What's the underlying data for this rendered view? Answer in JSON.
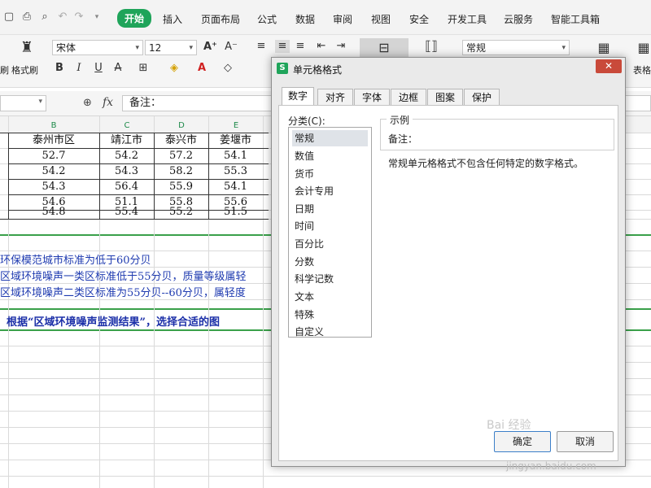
{
  "menubar": {
    "tabs": [
      "开始",
      "插入",
      "页面布局",
      "公式",
      "数据",
      "审阅",
      "视图",
      "安全",
      "开发工具",
      "云服务",
      "智能工具箱"
    ],
    "active_tab": "开始"
  },
  "ribbon": {
    "paste_label_partial": "刷",
    "format_painter_label": "格式刷",
    "font_name": "宋体",
    "font_size": "12",
    "number_format": "常规",
    "table_label_partial": "表格"
  },
  "formula_bar": {
    "fx_label": "fx",
    "content": "备注："
  },
  "sheet": {
    "col_headers": [
      "B",
      "C",
      "D",
      "E"
    ],
    "header_row": [
      "泰州市区",
      "靖江市",
      "泰兴市",
      "姜堰市"
    ],
    "rows": [
      [
        "52.7",
        "54.2",
        "57.2",
        "54.1"
      ],
      [
        "54.2",
        "54.3",
        "58.2",
        "55.3"
      ],
      [
        "54.3",
        "56.4",
        "55.9",
        "54.1"
      ],
      [
        "54.6",
        "51.1",
        "55.8",
        "55.6"
      ],
      [
        "54.8",
        "55.4",
        "55.2",
        "51.5"
      ]
    ],
    "notes": [
      "环保模范城市标准为低于60分贝",
      "区域环境噪声一类区标准低于55分贝，质量等级属轻",
      "区域环境噪声二类区标准为55分贝--60分贝，属轻度"
    ],
    "question": "根据“区域环境噪声监测结果”，选择合适的图"
  },
  "dialog": {
    "title": "单元格格式",
    "tabs": [
      "数字",
      "对齐",
      "字体",
      "边框",
      "图案",
      "保护"
    ],
    "active_tab": "数字",
    "category_label": "分类(C):",
    "categories": [
      "常规",
      "数值",
      "货币",
      "会计专用",
      "日期",
      "时间",
      "百分比",
      "分数",
      "科学记数",
      "文本",
      "特殊",
      "自定义"
    ],
    "selected_category": "常规",
    "sample_label": "示例",
    "sample_value": "备注：",
    "description": "常规单元格格式不包含任何特定的数字格式。",
    "ok_label": "确定",
    "cancel_label": "取消"
  },
  "watermark": {
    "logo_text": "Bai 经验",
    "url": "jingyan.baidu.com"
  }
}
